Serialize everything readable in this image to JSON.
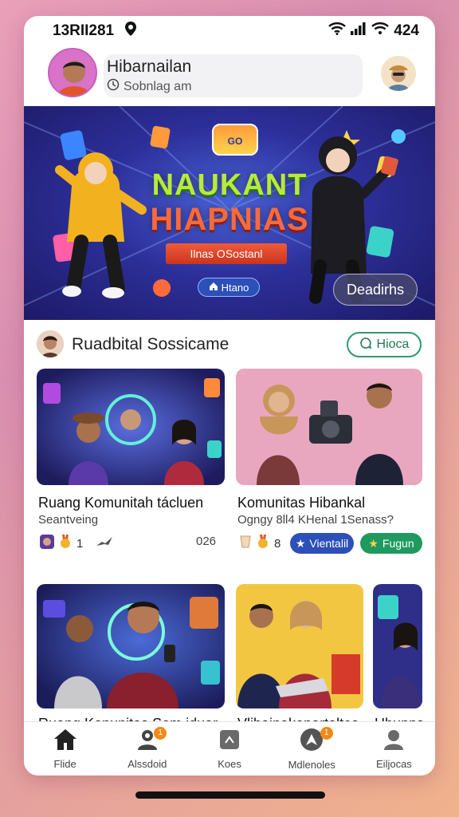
{
  "status_bar": {
    "time": "13RII281",
    "battery": "424"
  },
  "profile": {
    "name": "Hibarnailan",
    "subtitle": "Sobnlag am"
  },
  "banner": {
    "logo_text": "GO",
    "title_line1": "NAUKANT",
    "title_line2": "HIAPNIAS",
    "ribbon": "Ilnas OSostanl",
    "chip": "Htano",
    "button": "Deadirhs"
  },
  "section": {
    "title": "Ruadbital Sossicame",
    "follow": "Hioca"
  },
  "cards": [
    {
      "title": "Ruang Komunitah tácluen",
      "subtitle": "Seantveing",
      "count": "1",
      "right_meta": "026"
    },
    {
      "title": "Komunitas Hibankal",
      "subtitle": "Ogngy 8ll4 KHenal 1Senass?",
      "count": "8",
      "tag1": "Vientalil",
      "tag2": "Fugun"
    },
    {
      "title": "Ruang Konunitas Som iduar"
    },
    {
      "title": "Vlibainakonartaltes"
    },
    {
      "title": "Hbunns"
    }
  ],
  "nav": {
    "items": [
      {
        "label": "Flide",
        "icon": "home-icon"
      },
      {
        "label": "Alssdoid",
        "icon": "people-icon",
        "badge": "1"
      },
      {
        "label": "Koes",
        "icon": "box-icon"
      },
      {
        "label": "Mdlenoles",
        "icon": "compass-icon",
        "badge": "1"
      },
      {
        "label": "Eiljocas",
        "icon": "user-icon"
      }
    ]
  },
  "colors": {
    "accent_green": "#2e9a6b",
    "tag_blue": "#2c4fb8",
    "tag_green": "#1f9a5e",
    "badge_orange": "#f08a18"
  }
}
